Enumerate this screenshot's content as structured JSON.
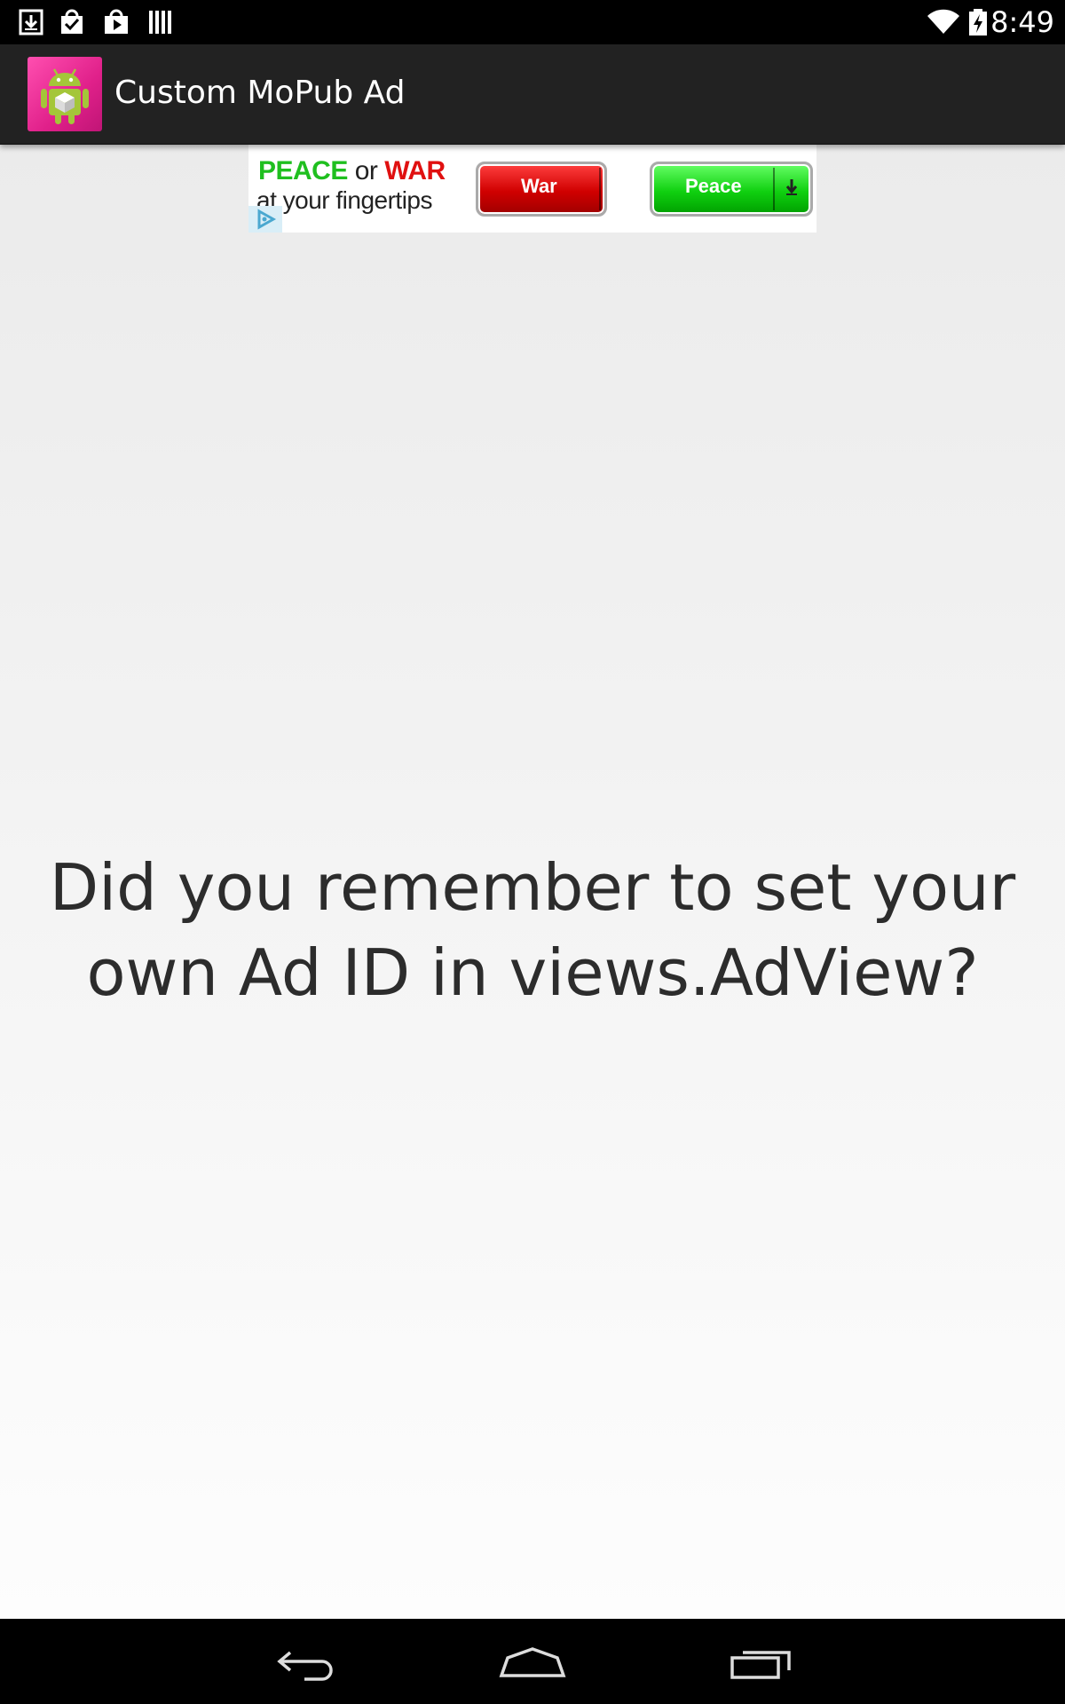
{
  "status_bar": {
    "time": "8:49",
    "icons": [
      "download-icon",
      "task-done-icon",
      "play-store-icon",
      "barcode-icon",
      "wifi-icon",
      "battery-charging-icon"
    ]
  },
  "action_bar": {
    "title": "Custom MoPub Ad",
    "icon": "android-app-icon"
  },
  "ad": {
    "headline_peace": "PEACE",
    "headline_or": "or",
    "headline_war": "WAR",
    "tagline": "at your fingertips",
    "war_button_label": "War",
    "peace_button_label": "Peace",
    "colors": {
      "peace": "#1fbf1f",
      "war": "#e01010"
    }
  },
  "content": {
    "message": "Did you remember to set your own Ad ID in views.AdView?"
  },
  "nav_bar": {
    "buttons": [
      "back-icon",
      "home-icon",
      "recent-apps-icon"
    ]
  }
}
